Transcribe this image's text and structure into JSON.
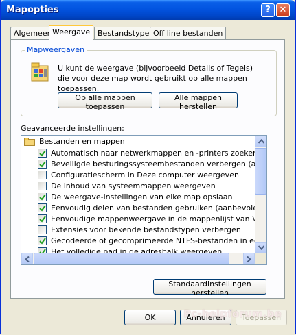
{
  "window": {
    "title": "Mapopties"
  },
  "titlebar": {
    "help_label": "?",
    "close_label": "✕"
  },
  "tabs": [
    {
      "label": "Algemeen",
      "active": false
    },
    {
      "label": "Weergave",
      "active": true
    },
    {
      "label": "Bestandstypen",
      "active": false
    },
    {
      "label": "Off line bestanden",
      "active": false
    }
  ],
  "folder_views": {
    "group_label": "Mapweergaven",
    "description": "U kunt de weergave (bijvoorbeeld Details of Tegels) die voor deze map wordt gebruikt op alle mappen toepassen.",
    "apply_all_label": "Op alle mappen toepassen",
    "reset_all_label": "Alle mappen herstellen",
    "icon": "folder-options-icon"
  },
  "advanced": {
    "label": "Geavanceerde instellingen:",
    "root_label": "Bestanden en mappen",
    "items": [
      {
        "label": "Automatisch naar netwerkmappen en -printers zoeken",
        "checked": true
      },
      {
        "label": "Beveiligde besturingssysteembestanden verbergen (aanbevolen)",
        "checked": true
      },
      {
        "label": "Configuratiescherm in Deze computer weergeven",
        "checked": false
      },
      {
        "label": "De inhoud van systeemmappen weergeven",
        "checked": false
      },
      {
        "label": "De weergave-instellingen van elke map opslaan",
        "checked": true
      },
      {
        "label": "Eenvoudig delen van bestanden gebruiken (aanbevolen)",
        "checked": true
      },
      {
        "label": "Eenvoudige mappenweergave in de mappenlijst van Verkenner",
        "checked": true
      },
      {
        "label": "Extensies voor bekende bestandstypen verbergen",
        "checked": false
      },
      {
        "label": "Gecodeerde of gecomprimeerde NTFS-bestanden in een andere kleur",
        "checked": true
      },
      {
        "label": "Het volledige pad in de adresbalk weergeven",
        "checked": true
      }
    ],
    "restore_defaults_label": "Standaardinstellingen herstellen"
  },
  "footer": {
    "ok_label": "OK",
    "cancel_label": "Annuleren",
    "apply_label": "Toepassen",
    "watermark": "Pc-helpforum.be"
  },
  "colors": {
    "titlebar": "#0254E0",
    "face": "#ECE9D8",
    "group_label": "#0046D5",
    "check": "#21A121"
  }
}
